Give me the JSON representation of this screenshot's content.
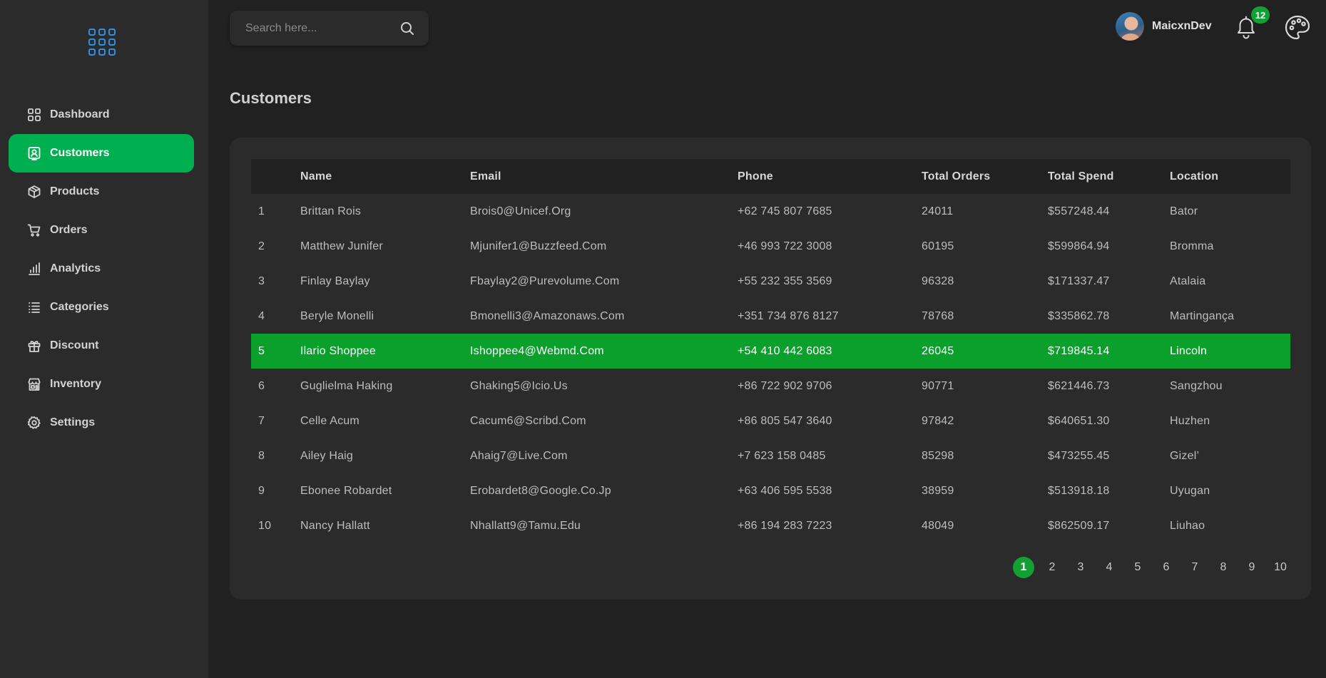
{
  "sidebar": {
    "items": [
      {
        "label": "Dashboard",
        "icon": "dashboard-icon",
        "active": false
      },
      {
        "label": "Customers",
        "icon": "customer-icon",
        "active": true
      },
      {
        "label": "Products",
        "icon": "package-icon",
        "active": false
      },
      {
        "label": "Orders",
        "icon": "cart-icon",
        "active": false
      },
      {
        "label": "Analytics",
        "icon": "analytics-icon",
        "active": false
      },
      {
        "label": "Categories",
        "icon": "list-icon",
        "active": false
      },
      {
        "label": "Discount",
        "icon": "gift-icon",
        "active": false
      },
      {
        "label": "Inventory",
        "icon": "store-icon",
        "active": false
      },
      {
        "label": "Settings",
        "icon": "gear-icon",
        "active": false
      }
    ]
  },
  "header": {
    "search_placeholder": "Search here...",
    "user_name": "MaicxnDev",
    "notification_count": "12"
  },
  "page": {
    "title": "Customers"
  },
  "table": {
    "columns": [
      "",
      "Name",
      "Email",
      "Phone",
      "Total Orders",
      "Total Spend",
      "Location"
    ],
    "rows": [
      [
        "1",
        "Brittan Rois",
        "Brois0@Unicef.Org",
        "+62 745 807 7685",
        "24011",
        "$557248.44",
        "Bator"
      ],
      [
        "2",
        "Matthew Junifer",
        "Mjunifer1@Buzzfeed.Com",
        "+46 993 722 3008",
        "60195",
        "$599864.94",
        "Bromma"
      ],
      [
        "3",
        "Finlay Baylay",
        "Fbaylay2@Purevolume.Com",
        "+55 232 355 3569",
        "96328",
        "$171337.47",
        "Atalaia"
      ],
      [
        "4",
        "Beryle Monelli",
        "Bmonelli3@Amazonaws.Com",
        "+351 734 876 8127",
        "78768",
        "$335862.78",
        "Martingança"
      ],
      [
        "5",
        "Ilario Shoppee",
        "Ishoppee4@Webmd.Com",
        "+54 410 442 6083",
        "26045",
        "$719845.14",
        "Lincoln"
      ],
      [
        "6",
        "Guglielma Haking",
        "Ghaking5@Icio.Us",
        "+86 722 902 9706",
        "90771",
        "$621446.73",
        "Sangzhou"
      ],
      [
        "7",
        "Celle Acum",
        "Cacum6@Scribd.Com",
        "+86 805 547 3640",
        "97842",
        "$640651.30",
        "Huzhen"
      ],
      [
        "8",
        "Ailey Haig",
        "Ahaig7@Live.Com",
        "+7 623 158 0485",
        "85298",
        "$473255.45",
        "Gizel’"
      ],
      [
        "9",
        "Ebonee Robardet",
        "Erobardet8@Google.Co.Jp",
        "+63 406 595 5538",
        "38959",
        "$513918.18",
        "Uyugan"
      ],
      [
        "10",
        "Nancy Hallatt",
        "Nhallatt9@Tamu.Edu",
        "+86 194 283 7223",
        "48049",
        "$862509.17",
        "Liuhao"
      ]
    ],
    "selected_row": 4
  },
  "pagination": {
    "pages": [
      "1",
      "2",
      "3",
      "4",
      "5",
      "6",
      "7",
      "8",
      "9",
      "10"
    ],
    "current": "1"
  },
  "colors": {
    "accent": "#00b050",
    "selected_row": "#0aa02b",
    "logo": "#2f8fe0",
    "background": "#212121",
    "panel": "#2b2b2b"
  }
}
